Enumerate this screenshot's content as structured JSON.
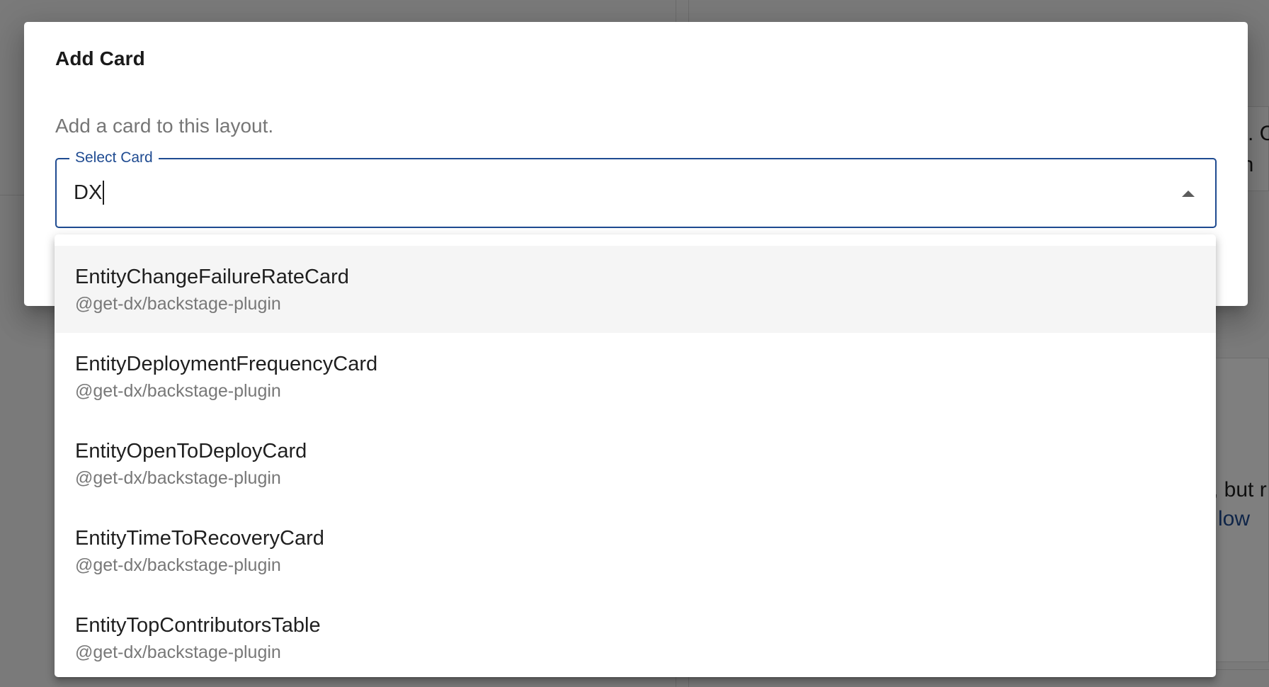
{
  "background": {
    "fragment_1": "s. C",
    "fragment_2": "in",
    "fragment_3": ", but r",
    "fragment_4": "low"
  },
  "dialog": {
    "title": "Add Card",
    "description": "Add a card to this layout."
  },
  "select_card": {
    "label": "Select Card",
    "value": "DX",
    "toggle_icon": "arrow-drop-up-icon"
  },
  "options": [
    {
      "title": "EntityChangeFailureRateCard",
      "package": "@get-dx/backstage-plugin",
      "highlighted": true
    },
    {
      "title": "EntityDeploymentFrequencyCard",
      "package": "@get-dx/backstage-plugin",
      "highlighted": false
    },
    {
      "title": "EntityOpenToDeployCard",
      "package": "@get-dx/backstage-plugin",
      "highlighted": false
    },
    {
      "title": "EntityTimeToRecoveryCard",
      "package": "@get-dx/backstage-plugin",
      "highlighted": false
    },
    {
      "title": "EntityTopContributorsTable",
      "package": "@get-dx/backstage-plugin",
      "highlighted": false
    }
  ],
  "colors": {
    "accent": "#1f4b91",
    "overlay": "rgba(0,0,0,0.5)",
    "highlight": "#f5f5f5"
  }
}
